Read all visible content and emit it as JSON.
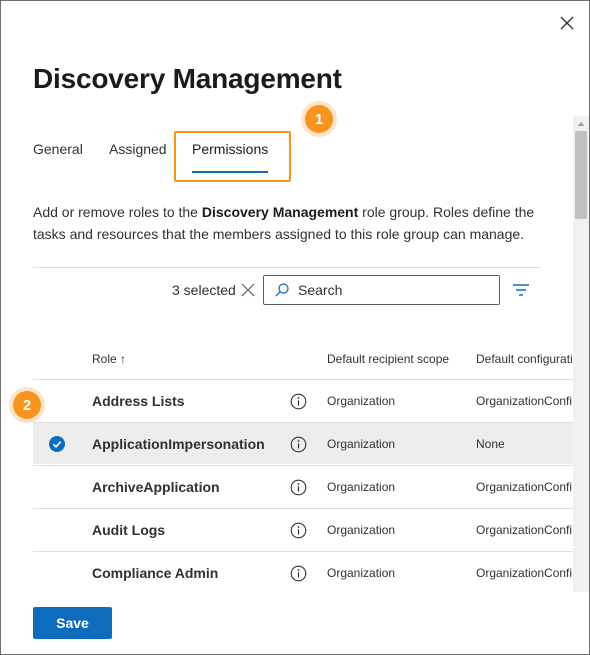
{
  "dialog": {
    "title": "Discovery Management"
  },
  "tabs": [
    {
      "label": "General"
    },
    {
      "label": "Assigned"
    },
    {
      "label": "Permissions"
    }
  ],
  "description": {
    "before": "Add or remove roles to the ",
    "bold": "Discovery Management",
    "after": " role group. Roles define the tasks and resources that the members assigned to this role group can manage."
  },
  "toolbar": {
    "selected_count": "3 selected",
    "search_placeholder": "Search"
  },
  "table": {
    "columns": [
      "Role ↑",
      "Default recipient scope",
      "Default configurati"
    ],
    "rows": [
      {
        "role": "Address Lists",
        "scope": "Organization",
        "config": "OrganizationConfi",
        "selected": false
      },
      {
        "role": "ApplicationImpersonation",
        "scope": "Organization",
        "config": "None",
        "selected": true
      },
      {
        "role": "ArchiveApplication",
        "scope": "Organization",
        "config": "OrganizationConfi",
        "selected": false
      },
      {
        "role": "Audit Logs",
        "scope": "Organization",
        "config": "OrganizationConfi",
        "selected": false
      },
      {
        "role": "Compliance Admin",
        "scope": "Organization",
        "config": "OrganizationConfi",
        "selected": false
      }
    ]
  },
  "callouts": [
    "1",
    "2"
  ],
  "footer": {
    "save_label": "Save"
  },
  "colors": {
    "accent": "#0f6cbd",
    "callout": "#f7941d",
    "selected_row": "#ededed"
  }
}
